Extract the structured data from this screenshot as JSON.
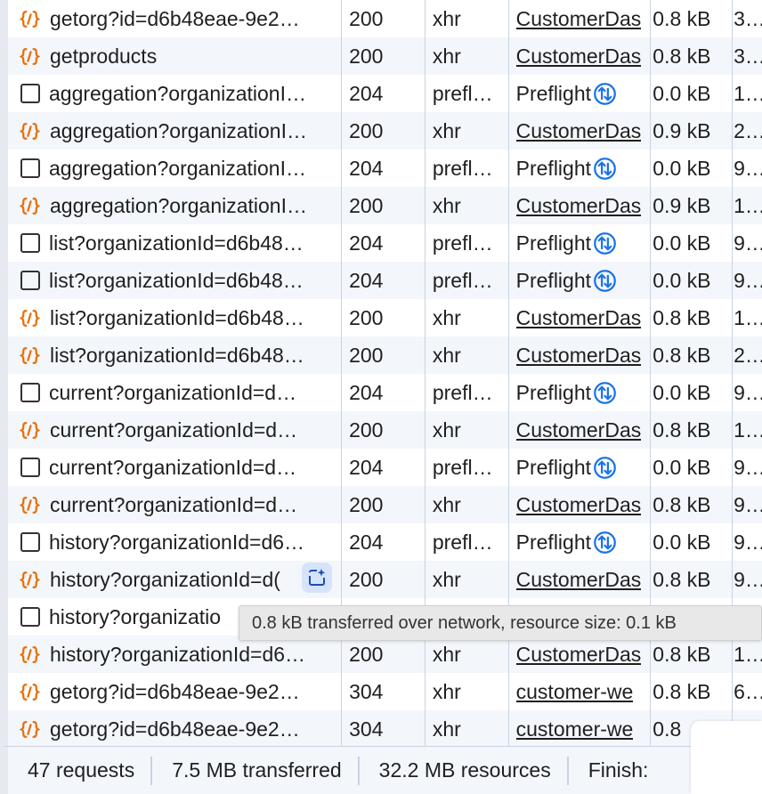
{
  "colors": {
    "accent": "#1a73e8",
    "xhr_icon": "#e8710a",
    "row_alt": "#f3f6fb",
    "divider": "#c9d3e3"
  },
  "rows": [
    {
      "icon": "xhr",
      "name": "getorg?id=d6b48eae-9e2…",
      "status": "200",
      "type": "xhr",
      "initiator": "CustomerDas",
      "initiator_link": true,
      "size": "0.8 kB",
      "time": "3…"
    },
    {
      "icon": "xhr",
      "name": "getproducts",
      "status": "200",
      "type": "xhr",
      "initiator": "CustomerDas",
      "initiator_link": true,
      "size": "0.8 kB",
      "time": "3…"
    },
    {
      "icon": "doc",
      "name": "aggregation?organizationI…",
      "status": "204",
      "type": "prefl…",
      "initiator": "Preflight",
      "initiator_link": false,
      "size": "0.0 kB",
      "time": "1…"
    },
    {
      "icon": "xhr",
      "name": "aggregation?organizationI…",
      "status": "200",
      "type": "xhr",
      "initiator": "CustomerDas",
      "initiator_link": true,
      "size": "0.9 kB",
      "time": "2…"
    },
    {
      "icon": "doc",
      "name": "aggregation?organizationI…",
      "status": "204",
      "type": "prefl…",
      "initiator": "Preflight",
      "initiator_link": false,
      "size": "0.0 kB",
      "time": "9…"
    },
    {
      "icon": "xhr",
      "name": "aggregation?organizationI…",
      "status": "200",
      "type": "xhr",
      "initiator": "CustomerDas",
      "initiator_link": true,
      "size": "0.9 kB",
      "time": "1…"
    },
    {
      "icon": "doc",
      "name": "list?organizationId=d6b48…",
      "status": "204",
      "type": "prefl…",
      "initiator": "Preflight",
      "initiator_link": false,
      "size": "0.0 kB",
      "time": "9…"
    },
    {
      "icon": "doc",
      "name": "list?organizationId=d6b48…",
      "status": "204",
      "type": "prefl…",
      "initiator": "Preflight",
      "initiator_link": false,
      "size": "0.0 kB",
      "time": "9…"
    },
    {
      "icon": "xhr",
      "name": "list?organizationId=d6b48…",
      "status": "200",
      "type": "xhr",
      "initiator": "CustomerDas",
      "initiator_link": true,
      "size": "0.8 kB",
      "time": "1…"
    },
    {
      "icon": "xhr",
      "name": "list?organizationId=d6b48…",
      "status": "200",
      "type": "xhr",
      "initiator": "CustomerDas",
      "initiator_link": true,
      "size": "0.8 kB",
      "time": "2…"
    },
    {
      "icon": "doc",
      "name": "current?organizationId=d…",
      "status": "204",
      "type": "prefl…",
      "initiator": "Preflight",
      "initiator_link": false,
      "size": "0.0 kB",
      "time": "9…"
    },
    {
      "icon": "xhr",
      "name": "current?organizationId=d…",
      "status": "200",
      "type": "xhr",
      "initiator": "CustomerDas",
      "initiator_link": true,
      "size": "0.8 kB",
      "time": "1…"
    },
    {
      "icon": "doc",
      "name": "current?organizationId=d…",
      "status": "204",
      "type": "prefl…",
      "initiator": "Preflight",
      "initiator_link": false,
      "size": "0.0 kB",
      "time": "9…"
    },
    {
      "icon": "xhr",
      "name": "current?organizationId=d…",
      "status": "200",
      "type": "xhr",
      "initiator": "CustomerDas",
      "initiator_link": true,
      "size": "0.8 kB",
      "time": "9…"
    },
    {
      "icon": "doc",
      "name": "history?organizationId=d6…",
      "status": "204",
      "type": "prefl…",
      "initiator": "Preflight",
      "initiator_link": false,
      "size": "0.0 kB",
      "time": "9…"
    },
    {
      "icon": "xhr",
      "name": "history?organizationId=d(",
      "status": "200",
      "type": "xhr",
      "initiator": "CustomerDas",
      "initiator_link": true,
      "size": "0.8 kB",
      "time": "9…"
    },
    {
      "icon": "doc",
      "name": "history?organizatio",
      "status": "",
      "type": "",
      "initiator": "",
      "initiator_link": false,
      "size": "",
      "time": ""
    },
    {
      "icon": "xhr",
      "name": "history?organizationId=d6…",
      "status": "200",
      "type": "xhr",
      "initiator": "CustomerDas",
      "initiator_link": true,
      "size": "0.8 kB",
      "time": "1…"
    },
    {
      "icon": "xhr",
      "name": "getorg?id=d6b48eae-9e2…",
      "status": "304",
      "type": "xhr",
      "initiator": "customer-we",
      "initiator_link": true,
      "size": "0.8 kB",
      "time": "6…"
    },
    {
      "icon": "xhr",
      "name": "getorg?id=d6b48eae-9e2…",
      "status": "304",
      "type": "xhr",
      "initiator": "customer-we",
      "initiator_link": true,
      "size": "0.8",
      "time": ""
    }
  ],
  "tooltip": "0.8 kB transferred over network, resource size: 0.1 kB",
  "footer": {
    "requests": "47 requests",
    "transferred": "7.5 MB transferred",
    "resources": "32.2 MB resources",
    "finish": "Finish:"
  }
}
